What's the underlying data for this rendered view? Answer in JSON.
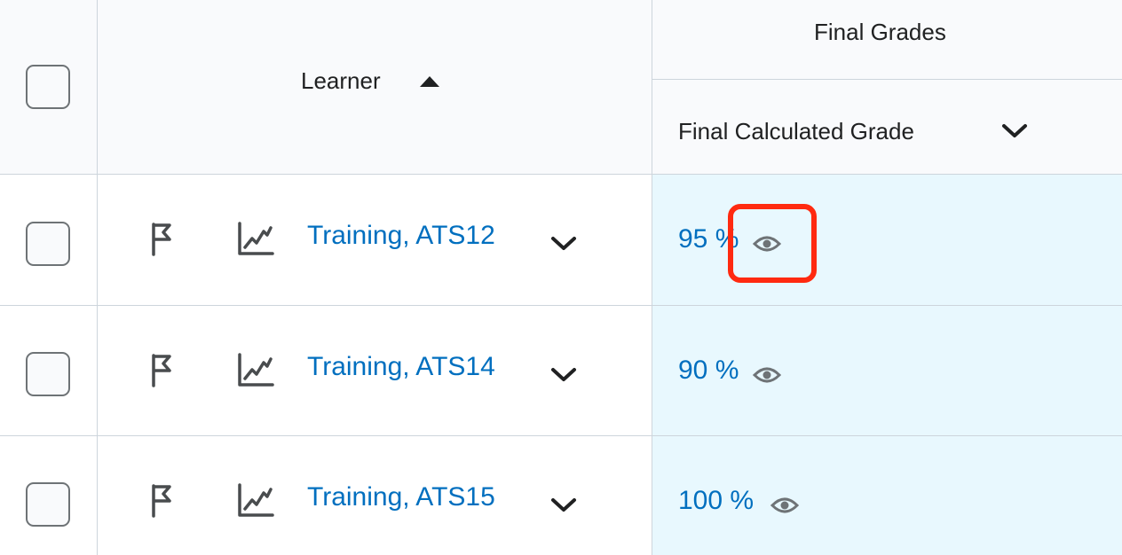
{
  "header": {
    "learner_label": "Learner",
    "group_label": "Final Grades",
    "column_label": "Final Calculated Grade"
  },
  "rows": [
    {
      "learner": "Training, ATS12",
      "grade": "95 %"
    },
    {
      "learner": "Training, ATS14",
      "grade": "90 %"
    },
    {
      "learner": "Training, ATS15",
      "grade": "100 %"
    }
  ],
  "icons": {
    "select_all": "checkbox",
    "sort": "caret-up-icon",
    "column_menu": "chevron-down-icon",
    "row_flag": "flag-icon",
    "row_progress": "line-chart-icon",
    "row_menu": "chevron-down-icon",
    "grade_visibility": "eye-icon"
  },
  "colors": {
    "link": "#006fbf",
    "header_bg": "#f9fafc",
    "grade_bg": "#e8f8fe",
    "highlight": "#ff2a10",
    "border": "#cdd5dc"
  }
}
